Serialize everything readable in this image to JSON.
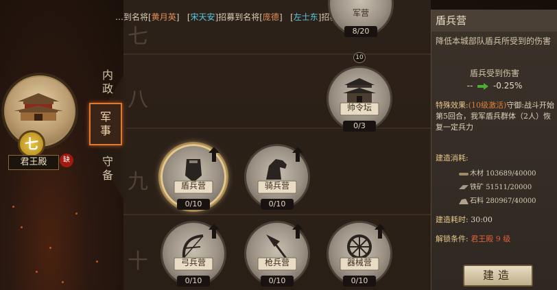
{
  "banner": {
    "frag_1": "…到名将[",
    "name_1": "黄月英",
    "frag_2": "]",
    "frag_3": "[",
    "name_2": "宋天安",
    "frag_4": "]招募到名将[",
    "name_3": "庞德",
    "frag_5": "]",
    "frag_6": "[",
    "name_4": "左士东",
    "frag_7": "]招募到名"
  },
  "palace": {
    "name": "君王殿",
    "level": "七",
    "lack": "缺"
  },
  "tabs": [
    {
      "label": "内政",
      "active": false
    },
    {
      "label": "军事",
      "active": true
    },
    {
      "label": "守备",
      "active": false
    }
  ],
  "row_numerals": [
    "七",
    "八",
    "九",
    "十"
  ],
  "nodes": {
    "top_partial": {
      "label": "军营",
      "count": "8/20"
    },
    "connector_badge": "10",
    "shuailing": {
      "label": "帅令坛",
      "count": "0/3"
    },
    "dunbing": {
      "label": "盾兵营",
      "count": "0/10"
    },
    "qibing": {
      "label": "骑兵营",
      "count": "0/10"
    },
    "gongbing": {
      "label": "弓兵营",
      "count": "0/10"
    },
    "qiangbing": {
      "label": "枪兵营",
      "count": "0/10"
    },
    "qixie": {
      "label": "器械营",
      "count": "0/10"
    }
  },
  "panel": {
    "title": "盾兵营",
    "desc": "降低本城部队盾兵所受到的伤害",
    "dmg_title": "盾兵受到伤害",
    "dmg_from": "--",
    "dmg_to": "-0.25%",
    "special_key": "特殊效果:",
    "special_hl": "(10级激活)",
    "special_text": "守御:战斗开始第5回合，我军盾兵群体（2人）恢复一定兵力",
    "cost_header": "建造消耗:",
    "costs": [
      {
        "icon": "wood-icon",
        "label": "木材",
        "value": "103689/40000"
      },
      {
        "icon": "iron-icon",
        "label": "铁矿",
        "value": "51511/20000"
      },
      {
        "icon": "stone-icon",
        "label": "石料",
        "value": "280967/40000"
      }
    ],
    "time_label": "建造耗时:",
    "time_value": "30:00",
    "unlock_label": "解锁条件:",
    "unlock_value": "君王殿 9 级",
    "build_button": "建造"
  },
  "colors": {
    "accent_orange": "#e07a32",
    "name_orange": "#e0905a",
    "name_cyan": "#58c8e0",
    "gold_text": "#e6c88a",
    "green_arrow": "#4caf32"
  }
}
